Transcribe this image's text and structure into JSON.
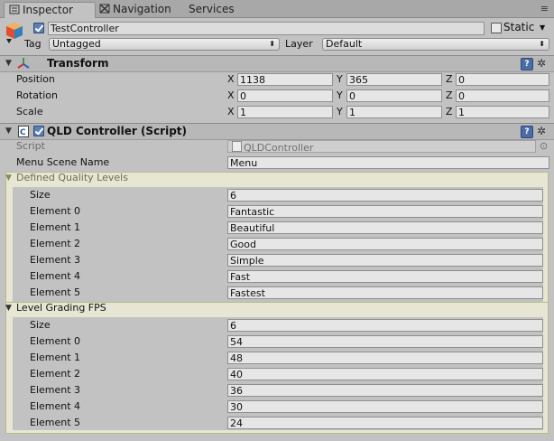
{
  "tabs": {
    "inspector": "Inspector",
    "navigation": "Navigation",
    "services": "Services",
    "menu_glyph": "≡"
  },
  "gameobject": {
    "name": "TestController",
    "active": true,
    "static_label": "Static",
    "tag_label": "Tag",
    "tag_value": "Untagged",
    "layer_label": "Layer",
    "layer_value": "Default"
  },
  "transform": {
    "title": "Transform",
    "position_label": "Position",
    "rotation_label": "Rotation",
    "scale_label": "Scale",
    "axes": [
      "X",
      "Y",
      "Z"
    ],
    "position": [
      "1138",
      "365",
      "0"
    ],
    "rotation": [
      "0",
      "0",
      "0"
    ],
    "scale": [
      "1",
      "1",
      "1"
    ]
  },
  "script_component": {
    "title": "QLD Controller (Script)",
    "enabled": true,
    "script_label": "Script",
    "script_value": "QLDController",
    "menu_scene_label": "Menu Scene Name",
    "menu_scene_value": "Menu",
    "quality_header": "Defined Quality Levels",
    "fps_header": "Level Grading FPS",
    "size_label": "Size",
    "quality_size": "6",
    "fps_size": "6",
    "element_labels": [
      "Element 0",
      "Element 1",
      "Element 2",
      "Element 3",
      "Element 4",
      "Element 5"
    ],
    "quality_values": [
      "Fantastic",
      "Beautiful",
      "Good",
      "Simple",
      "Fast",
      "Fastest"
    ],
    "fps_values": [
      "54",
      "48",
      "40",
      "36",
      "30",
      "24"
    ]
  },
  "icons": {
    "help": "?",
    "gear": "✲",
    "fold_open": "▼",
    "popup_arrow": "⬍",
    "dropdown_arrow": "▼",
    "object_picker": "⊙"
  },
  "colors": {
    "highlight_bg": "#e6e6d3",
    "accent_blue": "#4b6da6"
  }
}
